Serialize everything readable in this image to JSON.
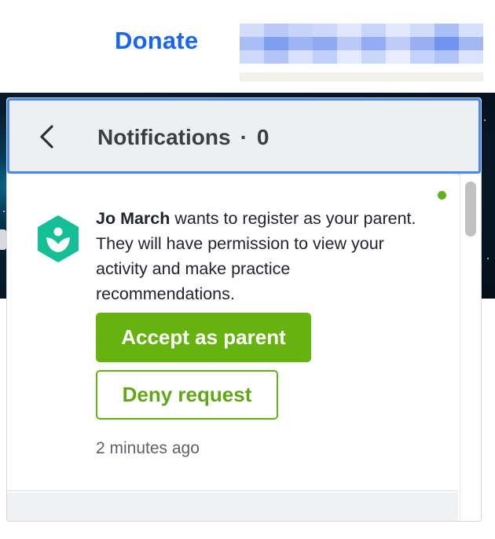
{
  "header": {
    "donate_label": "Donate"
  },
  "notifications": {
    "title": "Notifications",
    "separator": "·",
    "count": "0",
    "items": [
      {
        "sender": "Jo March",
        "message": " wants to register as your parent. They will have permission to view your activity and make practice recommendations.",
        "accept_label": "Accept as parent",
        "deny_label": "Deny request",
        "time": "2 minutes ago",
        "unread": true,
        "icon": "khan-academy-logo-icon"
      }
    ]
  },
  "colors": {
    "accent_blue": "#1865f2",
    "action_green": "#66b20f",
    "unread_dot": "#5fb41d",
    "header_bg": "#eeeff1",
    "focus_ring": "#4a86f0",
    "logo_teal": "#14bf96"
  }
}
